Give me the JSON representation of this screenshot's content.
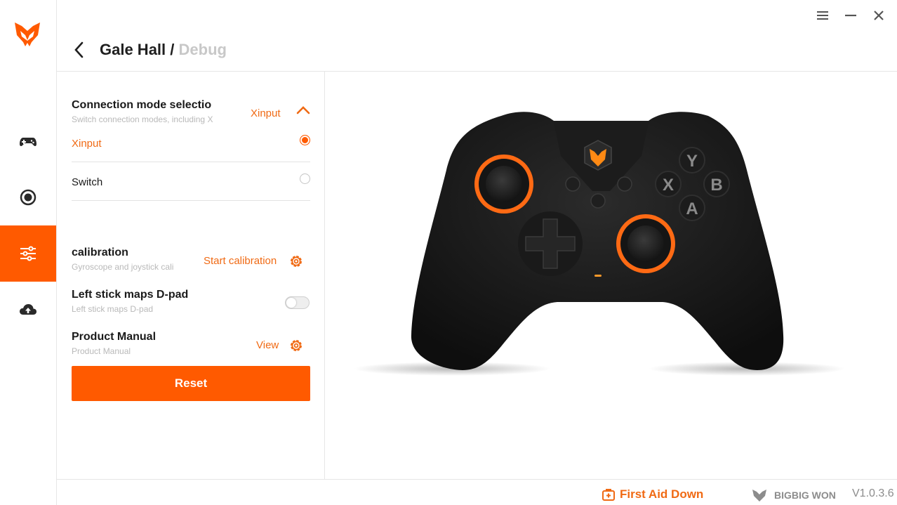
{
  "header": {
    "title": "Gale Hall",
    "separator": "/",
    "subtitle": "Debug"
  },
  "connection": {
    "title": "Connection mode selectio",
    "subtitle": "Switch connection modes, including X",
    "current_value": "Xinput",
    "options": [
      {
        "label": "Xinput",
        "selected": true
      },
      {
        "label": "Switch",
        "selected": false
      }
    ]
  },
  "calibration": {
    "title": "calibration",
    "subtitle": "Gyroscope and joystick cali",
    "action_label": "Start calibration"
  },
  "left_stick": {
    "title": "Left stick maps D-pad",
    "subtitle": "Left stick maps D-pad",
    "enabled": false
  },
  "manual": {
    "title": "Product Manual",
    "subtitle": "Product Manual",
    "action_label": "View"
  },
  "reset_label": "Reset",
  "controller": {
    "buttons": {
      "y": "Y",
      "x": "X",
      "b": "B",
      "a": "A"
    }
  },
  "footer": {
    "first_aid": "First Aid Down",
    "brand": "BIGBIG WON",
    "version": "V1.0.3.6"
  },
  "colors": {
    "accent": "#ff5a00",
    "accent_text": "#f06a14",
    "muted": "#b9b9b9"
  },
  "icons": {
    "rail": [
      "controller-icon",
      "target-icon",
      "sliders-icon",
      "cloud-upload-icon"
    ],
    "window": [
      "menu-icon",
      "minimize-icon",
      "close-icon"
    ]
  }
}
